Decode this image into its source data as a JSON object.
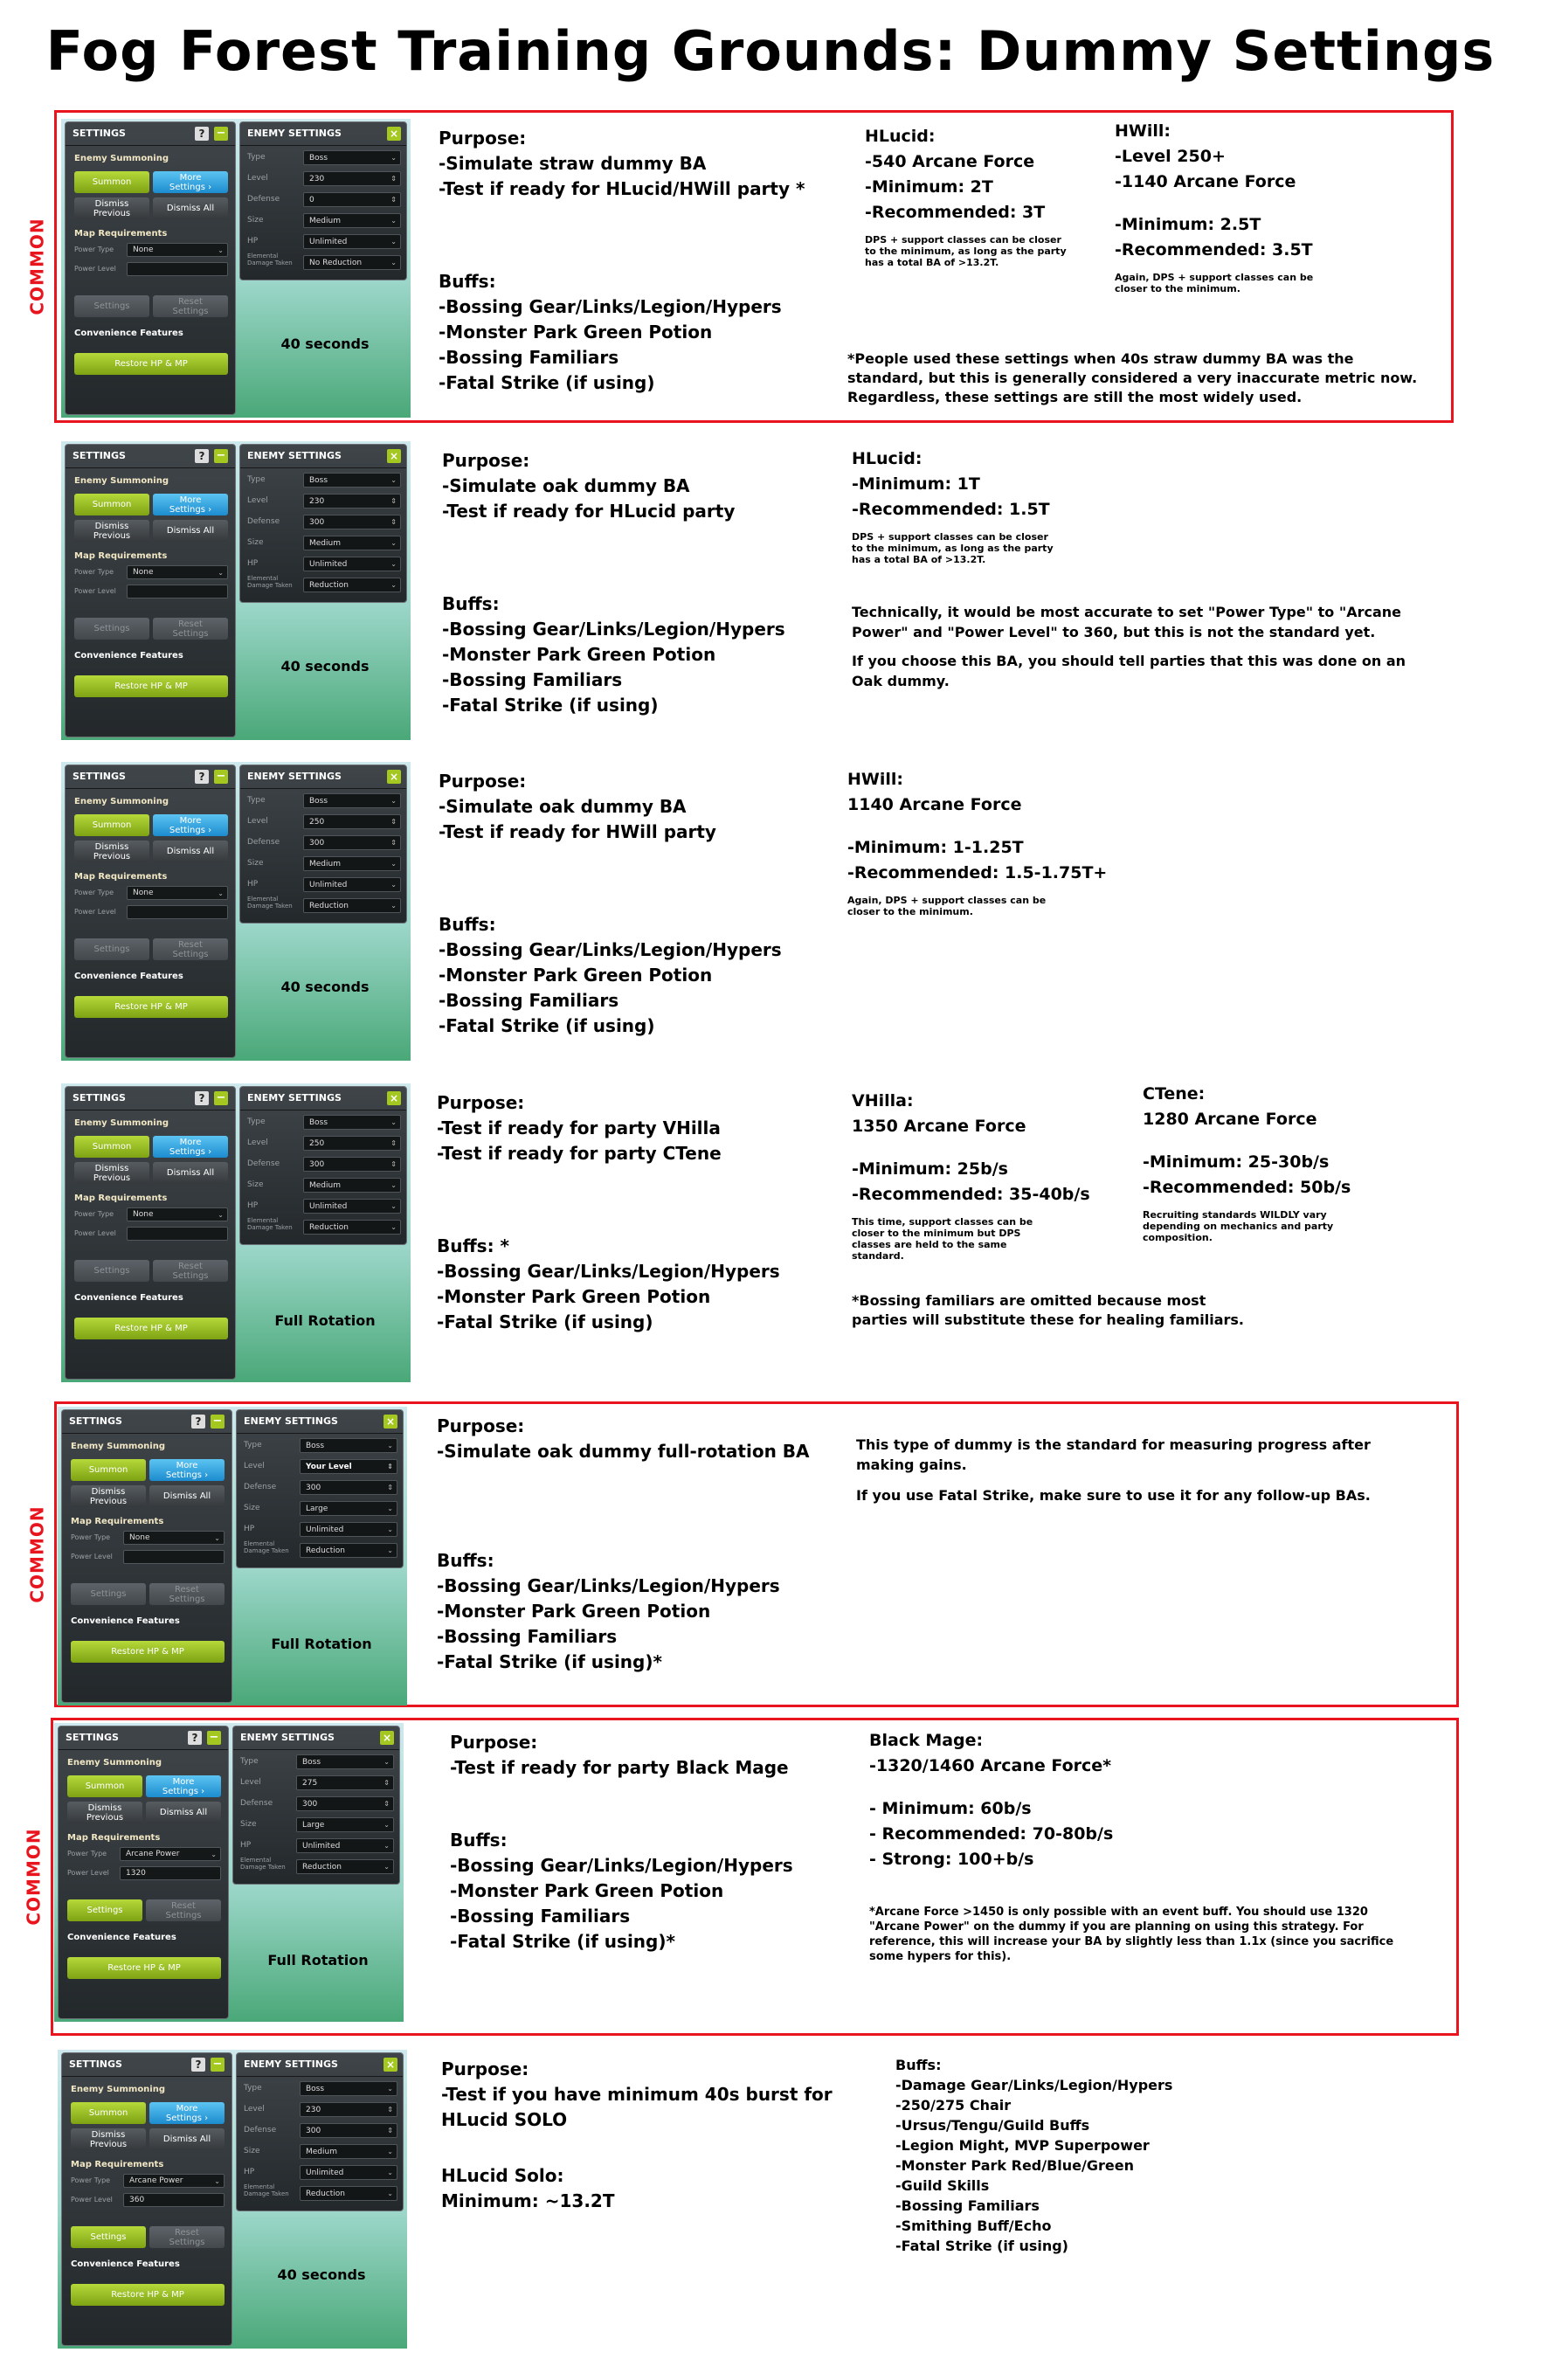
{
  "title": "Fog Forest Training Grounds: Dummy Settings",
  "common_label": "COMMON",
  "ui": {
    "settings_title": "SETTINGS",
    "enemy_settings_title": "ENEMY SETTINGS",
    "help": "?",
    "minimize": "−",
    "close": "×",
    "enemy_summoning": "Enemy Summoning",
    "summon": "Summon",
    "more_settings_1": "More",
    "more_settings_2": "Settings",
    "dismiss_prev_1": "Dismiss",
    "dismiss_prev_2": "Previous",
    "dismiss_all": "Dismiss All",
    "map_requirements": "Map Requirements",
    "power_type": "Power Type",
    "power_level": "Power Level",
    "settings_btn": "Settings",
    "reset_1": "Reset",
    "reset_2": "Settings",
    "convenience": "Convenience Features",
    "restore": "Restore HP & MP",
    "type": "Type",
    "level": "Level",
    "defense": "Defense",
    "size": "Size",
    "hp": "HP",
    "elem_1": "Elemental",
    "elem_2": "Damage Taken",
    "caret": "⌄"
  },
  "sections": [
    {
      "panel": {
        "type": "Boss",
        "level": "230",
        "defense": "0",
        "size": "Medium",
        "hp": "Unlimited",
        "elemental": "No Reduction",
        "power_type": "None",
        "power_level": "",
        "timer": "40 seconds"
      },
      "purpose_title": "Purpose:",
      "purpose_lines": [
        "-Simulate straw dummy BA",
        "-Test if ready for HLucid/HWill party *"
      ],
      "buffs_title": "Buffs:",
      "buffs": [
        "-Bossing Gear/Links/Legion/Hypers",
        "-Monster Park Green Potion",
        "-Bossing Familiars",
        "-Fatal Strike (if using)"
      ],
      "c1": {
        "title": "HLucid:",
        "lines": [
          "-540 Arcane Force",
          "-Minimum: 2T",
          "-Recommended: 3T"
        ],
        "small": "DPS + support classes can be closer to the minimum, as long as the party has a total BA of >13.2T."
      },
      "c2": {
        "title": "HWill:",
        "lines": [
          "-Level 250+",
          "-1140 Arcane Force",
          "",
          "-Minimum: 2.5T",
          "-Recommended: 3.5T"
        ],
        "small": "Again, DPS + support classes can be closer to the minimum."
      },
      "note": "*People used these settings when 40s straw dummy BA was the standard, but this is generally considered a very inaccurate metric now. Regardless, these settings are still the most widely used."
    },
    {
      "panel": {
        "type": "Boss",
        "level": "230",
        "defense": "300",
        "size": "Medium",
        "hp": "Unlimited",
        "elemental": "Reduction",
        "power_type": "None",
        "power_level": "",
        "timer": "40 seconds"
      },
      "purpose_title": "Purpose:",
      "purpose_lines": [
        "-Simulate oak dummy BA",
        "-Test if ready for HLucid party"
      ],
      "buffs_title": "Buffs:",
      "buffs": [
        "-Bossing Gear/Links/Legion/Hypers",
        "-Monster Park Green Potion",
        "-Bossing Familiars",
        "-Fatal Strike (if using)"
      ],
      "c1": {
        "title": "HLucid:",
        "lines": [
          "-Minimum: 1T",
          "-Recommended: 1.5T"
        ],
        "small": "DPS + support classes can be closer to the minimum, as long as the party has a total BA of >13.2T."
      },
      "note1": "Technically, it would be most accurate to set \"Power Type\" to \"Arcane Power\" and \"Power Level\" to 360, but this is not the standard yet.",
      "note2": "If you choose this BA, you should tell parties that this was done on an Oak dummy."
    },
    {
      "panel": {
        "type": "Boss",
        "level": "250",
        "defense": "300",
        "size": "Medium",
        "hp": "Unlimited",
        "elemental": "Reduction",
        "power_type": "None",
        "power_level": "",
        "timer": "40 seconds"
      },
      "purpose_title": "Purpose:",
      "purpose_lines": [
        "-Simulate oak dummy BA",
        "-Test if ready for HWill party"
      ],
      "buffs_title": "Buffs:",
      "buffs": [
        "-Bossing Gear/Links/Legion/Hypers",
        "-Monster Park Green Potion",
        "-Bossing Familiars",
        "-Fatal Strike (if using)"
      ],
      "c1": {
        "title": "HWill:",
        "lines": [
          "1140 Arcane Force",
          "",
          "-Minimum: 1-1.25T",
          "-Recommended: 1.5-1.75T+"
        ],
        "small": "Again, DPS + support classes can be closer to the minimum."
      }
    },
    {
      "panel": {
        "type": "Boss",
        "level": "250",
        "defense": "300",
        "size": "Medium",
        "hp": "Unlimited",
        "elemental": "Reduction",
        "power_type": "None",
        "power_level": "",
        "timer": "Full Rotation"
      },
      "purpose_title": "Purpose:",
      "purpose_lines": [
        "-Test if ready for party VHilla",
        "-Test if ready for party CTene"
      ],
      "buffs_title": "Buffs: *",
      "buffs": [
        "-Bossing Gear/Links/Legion/Hypers",
        "-Monster Park Green Potion",
        "-Fatal Strike (if using)"
      ],
      "c1": {
        "title": "VHilla:",
        "lines": [
          "1350 Arcane Force",
          "",
          "-Minimum: 25b/s",
          "-Recommended: 35-40b/s"
        ],
        "small": "This time, support classes can be closer to the minimum but DPS classes are held to the same standard."
      },
      "c2": {
        "title": "CTene:",
        "lines": [
          "1280 Arcane Force",
          "",
          "-Minimum: 25-30b/s",
          "-Recommended: 50b/s"
        ],
        "small": "Recruiting standards WILDLY vary depending on mechanics and party composition."
      },
      "note": "*Bossing familiars are omitted because most parties will substitute these for healing familiars."
    },
    {
      "panel": {
        "type": "Boss",
        "level": "Your Level",
        "defense": "300",
        "size": "Large",
        "hp": "Unlimited",
        "elemental": "Reduction",
        "power_type": "None",
        "power_level": "",
        "timer": "Full Rotation"
      },
      "purpose_title": "Purpose:",
      "purpose_lines": [
        "-Simulate oak dummy full-rotation BA"
      ],
      "buffs_title": "Buffs:",
      "buffs": [
        "-Bossing Gear/Links/Legion/Hypers",
        "-Monster Park Green Potion",
        "-Bossing Familiars",
        "-Fatal Strike (if using)*"
      ],
      "note1": "This type of dummy is the standard for measuring progress after making gains.",
      "note2": "If you use Fatal Strike, make sure to use it for any follow-up BAs."
    },
    {
      "panel": {
        "type": "Boss",
        "level": "275",
        "defense": "300",
        "size": "Large",
        "hp": "Unlimited",
        "elemental": "Reduction",
        "power_type": "Arcane Power",
        "power_level": "1320",
        "timer": "Full Rotation"
      },
      "purpose_title": "Purpose:",
      "purpose_lines": [
        "-Test if ready for party Black Mage"
      ],
      "buffs_title": "Buffs:",
      "buffs": [
        "-Bossing Gear/Links/Legion/Hypers",
        "-Monster Park Green Potion",
        "-Bossing Familiars",
        "-Fatal Strike (if using)*"
      ],
      "c1": {
        "title": "Black Mage:",
        "lines": [
          "-1320/1460 Arcane Force*",
          "",
          "- Minimum: 60b/s",
          "- Recommended: 70-80b/s",
          "- Strong: 100+b/s"
        ]
      },
      "note": "*Arcane Force >1450 is only possible with an event buff. You should use 1320 \"Arcane Power\" on the dummy if you are planning on using this strategy. For reference, this will increase your BA by slightly less than 1.1x (since you sacrifice some hypers for this)."
    },
    {
      "panel": {
        "type": "Boss",
        "level": "230",
        "defense": "300",
        "size": "Medium",
        "hp": "Unlimited",
        "elemental": "Reduction",
        "power_type": "Arcane Power",
        "power_level": "360",
        "timer": "40 seconds"
      },
      "purpose_title": "Purpose:",
      "purpose_lines": [
        "-Test if you have minimum 40s burst for",
        "HLucid SOLO"
      ],
      "solo_title": "HLucid Solo:",
      "solo_line": "Minimum: ~13.2T",
      "buffs_title": "Buffs:",
      "buffs": [
        "-Damage Gear/Links/Legion/Hypers",
        "-250/275 Chair",
        "-Ursus/Tengu/Guild Buffs",
        "-Legion Might, MVP Superpower",
        "-Monster Park Red/Blue/Green",
        "-Guild Skills",
        "-Bossing Familiars",
        "-Smithing Buff/Echo",
        "-Fatal Strike (if using)"
      ]
    }
  ]
}
